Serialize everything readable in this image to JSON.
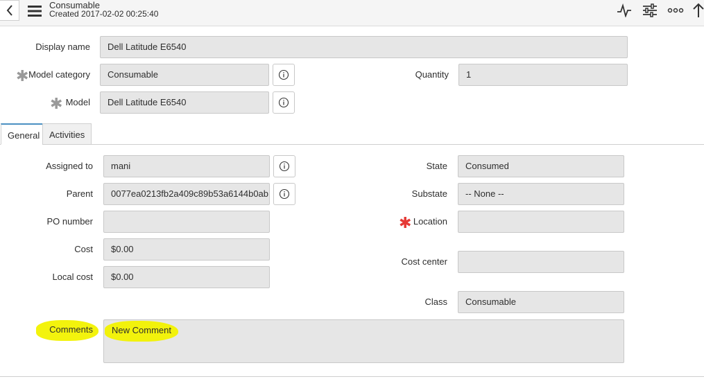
{
  "header": {
    "title": "Consumable",
    "created": "Created 2017-02-02 00:25:40",
    "icons": [
      "back-icon",
      "menu-icon",
      "activity-icon",
      "settings-icon",
      "more-icon",
      "up-arrow-icon"
    ]
  },
  "top_form": {
    "display_name": {
      "label": "Display name",
      "value": "Dell Latitude E6540"
    },
    "model_category": {
      "label": "Model category",
      "value": "Consumable"
    },
    "quantity": {
      "label": "Quantity",
      "value": "1"
    },
    "model": {
      "label": "Model",
      "value": "Dell Latitude E6540"
    }
  },
  "tabs": [
    {
      "label": "General",
      "active": true
    },
    {
      "label": "Activities",
      "active": false
    }
  ],
  "general": {
    "assigned_to": {
      "label": "Assigned to",
      "value": "mani"
    },
    "parent": {
      "label": "Parent",
      "value": "0077ea0213fb2a409c89b53a6144b0ab"
    },
    "po_number": {
      "label": "PO number",
      "value": ""
    },
    "cost": {
      "label": "Cost",
      "value": "$0.00"
    },
    "local_cost": {
      "label": "Local cost",
      "value": "$0.00"
    },
    "state": {
      "label": "State",
      "value": "Consumed"
    },
    "substate": {
      "label": "Substate",
      "value": "-- None --"
    },
    "location": {
      "label": "Location",
      "value": ""
    },
    "cost_center": {
      "label": "Cost center",
      "value": ""
    },
    "class": {
      "label": "Class",
      "value": "Consumable"
    },
    "comments": {
      "label": "Comments",
      "value": "New Comment"
    }
  },
  "colors": {
    "highlight": "#f2f200",
    "required_red": "#e53935",
    "tab_accent": "#4a90c2",
    "field_bg": "#e6e6e6"
  }
}
